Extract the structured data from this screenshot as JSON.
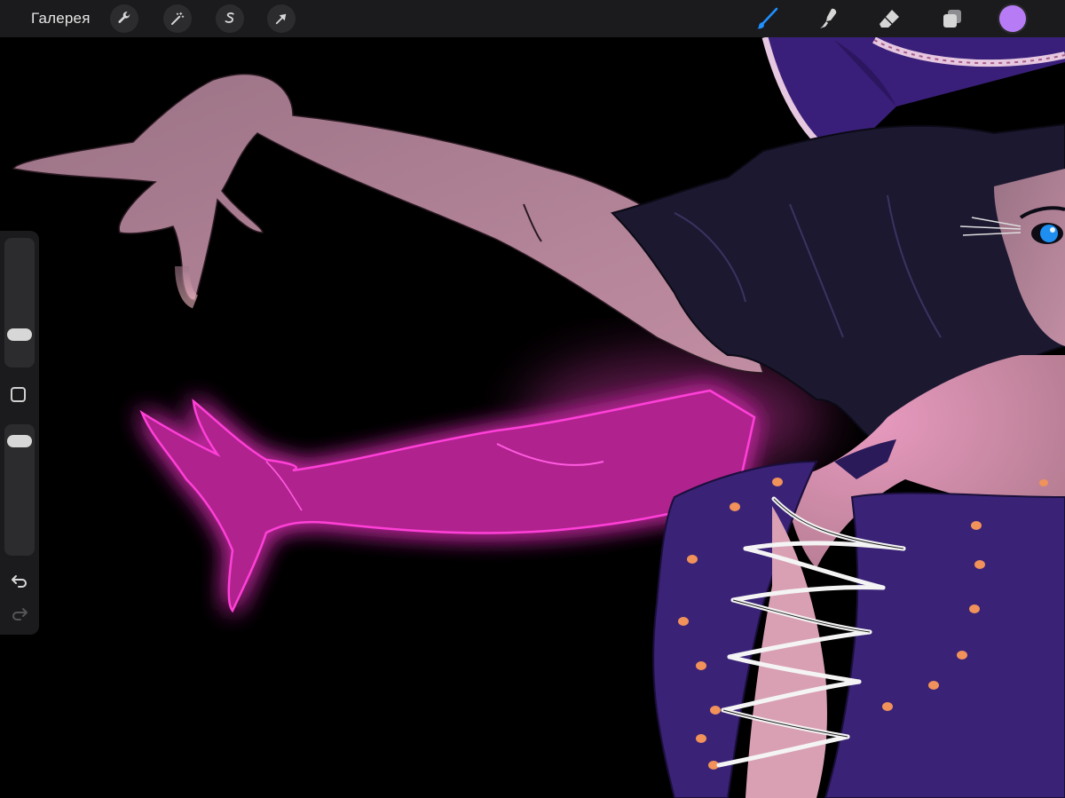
{
  "app": {
    "gallery_label": "Галерея"
  },
  "toolbar": {
    "left_tools": [
      {
        "name": "actions",
        "icon": "wrench-icon"
      },
      {
        "name": "adjustments",
        "icon": "magic-wand-icon"
      },
      {
        "name": "selection",
        "icon": "selection-s-icon"
      },
      {
        "name": "transform",
        "icon": "arrow-cursor-icon"
      }
    ],
    "right_tools": [
      {
        "name": "brush",
        "icon": "brush-icon",
        "active": true
      },
      {
        "name": "smudge",
        "icon": "smudge-finger-icon",
        "active": false
      },
      {
        "name": "eraser",
        "icon": "eraser-icon",
        "active": false
      },
      {
        "name": "layers",
        "icon": "layers-icon",
        "active": false
      }
    ],
    "current_color": "#b77cf5",
    "active_tool_color": "#1e90ff"
  },
  "sidebar": {
    "brush_size_level": 0.2,
    "opacity_level": 0.95,
    "undo_icon": "undo-icon",
    "redo_icon": "redo-icon",
    "modifier_icon": "square-modifier-icon"
  },
  "canvas": {
    "background": "#000000",
    "artwork": "witch-illustration"
  }
}
